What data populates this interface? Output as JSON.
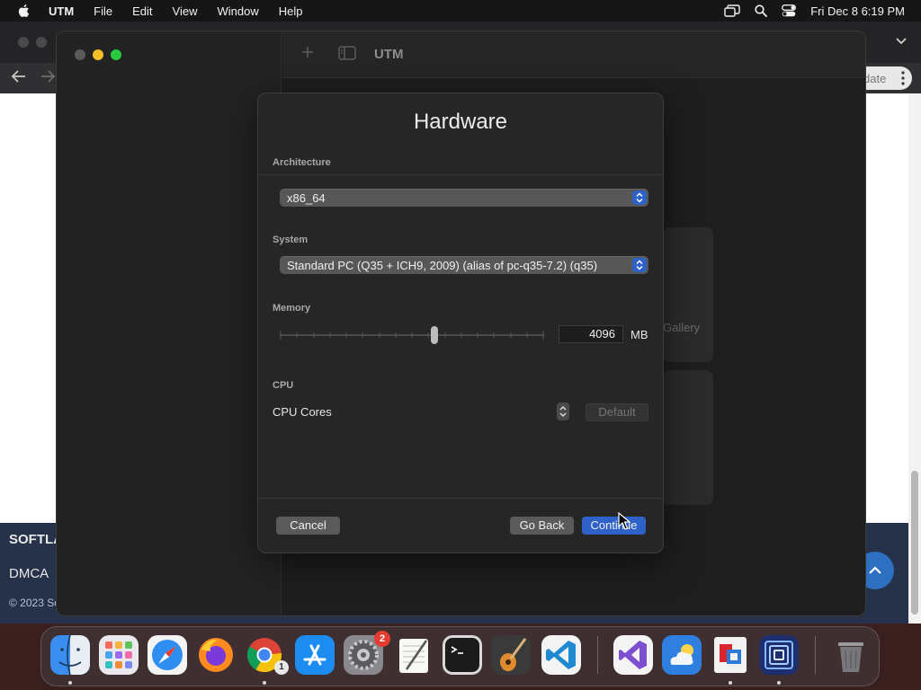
{
  "menubar": {
    "app_name": "UTM",
    "menus": [
      "File",
      "Edit",
      "View",
      "Window",
      "Help"
    ],
    "clock": "Fri Dec 8  6:19 PM"
  },
  "browser": {
    "update_label": "date",
    "footer_title": "SOFTLA",
    "footer_link": "DMCA",
    "footer_copyright": "© 2023 Softl"
  },
  "utm": {
    "window_title": "UTM",
    "gallery_peek": "Gallery"
  },
  "sheet": {
    "title": "Hardware",
    "architecture": {
      "label": "Architecture",
      "value": "x86_64"
    },
    "system": {
      "label": "System",
      "value": "Standard PC (Q35 + ICH9, 2009) (alias of pc-q35-7.2) (q35)"
    },
    "memory": {
      "label": "Memory",
      "value": "4096",
      "unit": "MB"
    },
    "cpu": {
      "label": "CPU",
      "cores_label": "CPU Cores",
      "default_label": "Default"
    },
    "buttons": {
      "cancel": "Cancel",
      "back": "Go Back",
      "continue": "Continue"
    }
  },
  "dock": {
    "apps": [
      "Finder",
      "Launchpad",
      "Safari",
      "Firefox",
      "Chrome",
      "App Store",
      "System Settings",
      "TextEdit",
      "Terminal",
      "GarageBand",
      "VS Code",
      "Visual Studio",
      "iCloud",
      "Parallels",
      "UTM",
      "Trash"
    ],
    "badges": {
      "system_settings": "2",
      "chrome": "1"
    }
  }
}
